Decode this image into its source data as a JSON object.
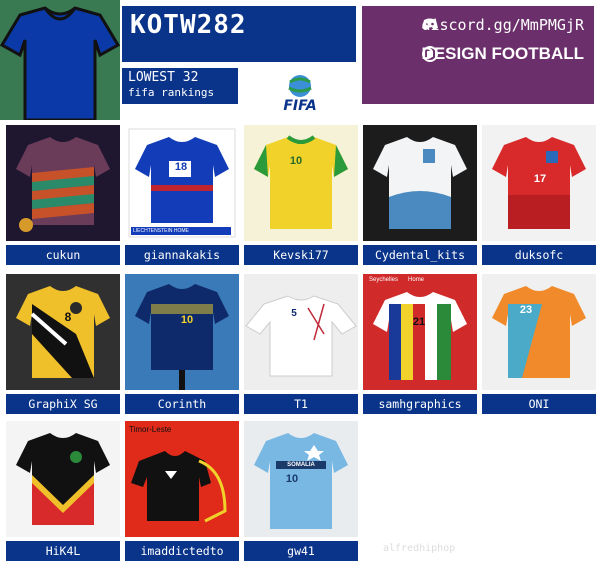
{
  "header": {
    "title": "KOTW282",
    "subtitle_line1": "LOWEST 32",
    "subtitle_line2": "fifa rankings",
    "fifa_logo_text": "FIFA",
    "discord_url": "discord.gg/MmPMGjR",
    "brand": "DESIGN FOOTBALL"
  },
  "entries": [
    {
      "name": "cukun"
    },
    {
      "name": "giannakakis",
      "kit_text": "LIECHTENSTEIN HOME",
      "number": "18"
    },
    {
      "name": "Kevski77",
      "number": "10"
    },
    {
      "name": "Cydental_kits"
    },
    {
      "name": "duksofc",
      "number": "17"
    },
    {
      "name": "GraphiX SG",
      "number": "8"
    },
    {
      "name": "Corinth",
      "number": "10"
    },
    {
      "name": "T1",
      "number": "5"
    },
    {
      "name": "samhgraphics",
      "kit_text": "Seychelles      Home",
      "number": "21"
    },
    {
      "name": "ONI",
      "number": "23"
    },
    {
      "name": "HiK4L"
    },
    {
      "name": "imaddictedto",
      "kit_text": "Timor-Leste"
    },
    {
      "name": "gw41",
      "kit_text": "SOMALIA",
      "number": "10"
    }
  ],
  "watermark": "alfredhiphop",
  "colors": {
    "label_bg": "#0a3489",
    "discord_bg": "#6b2f6c",
    "header_green": "#3a7a52"
  }
}
